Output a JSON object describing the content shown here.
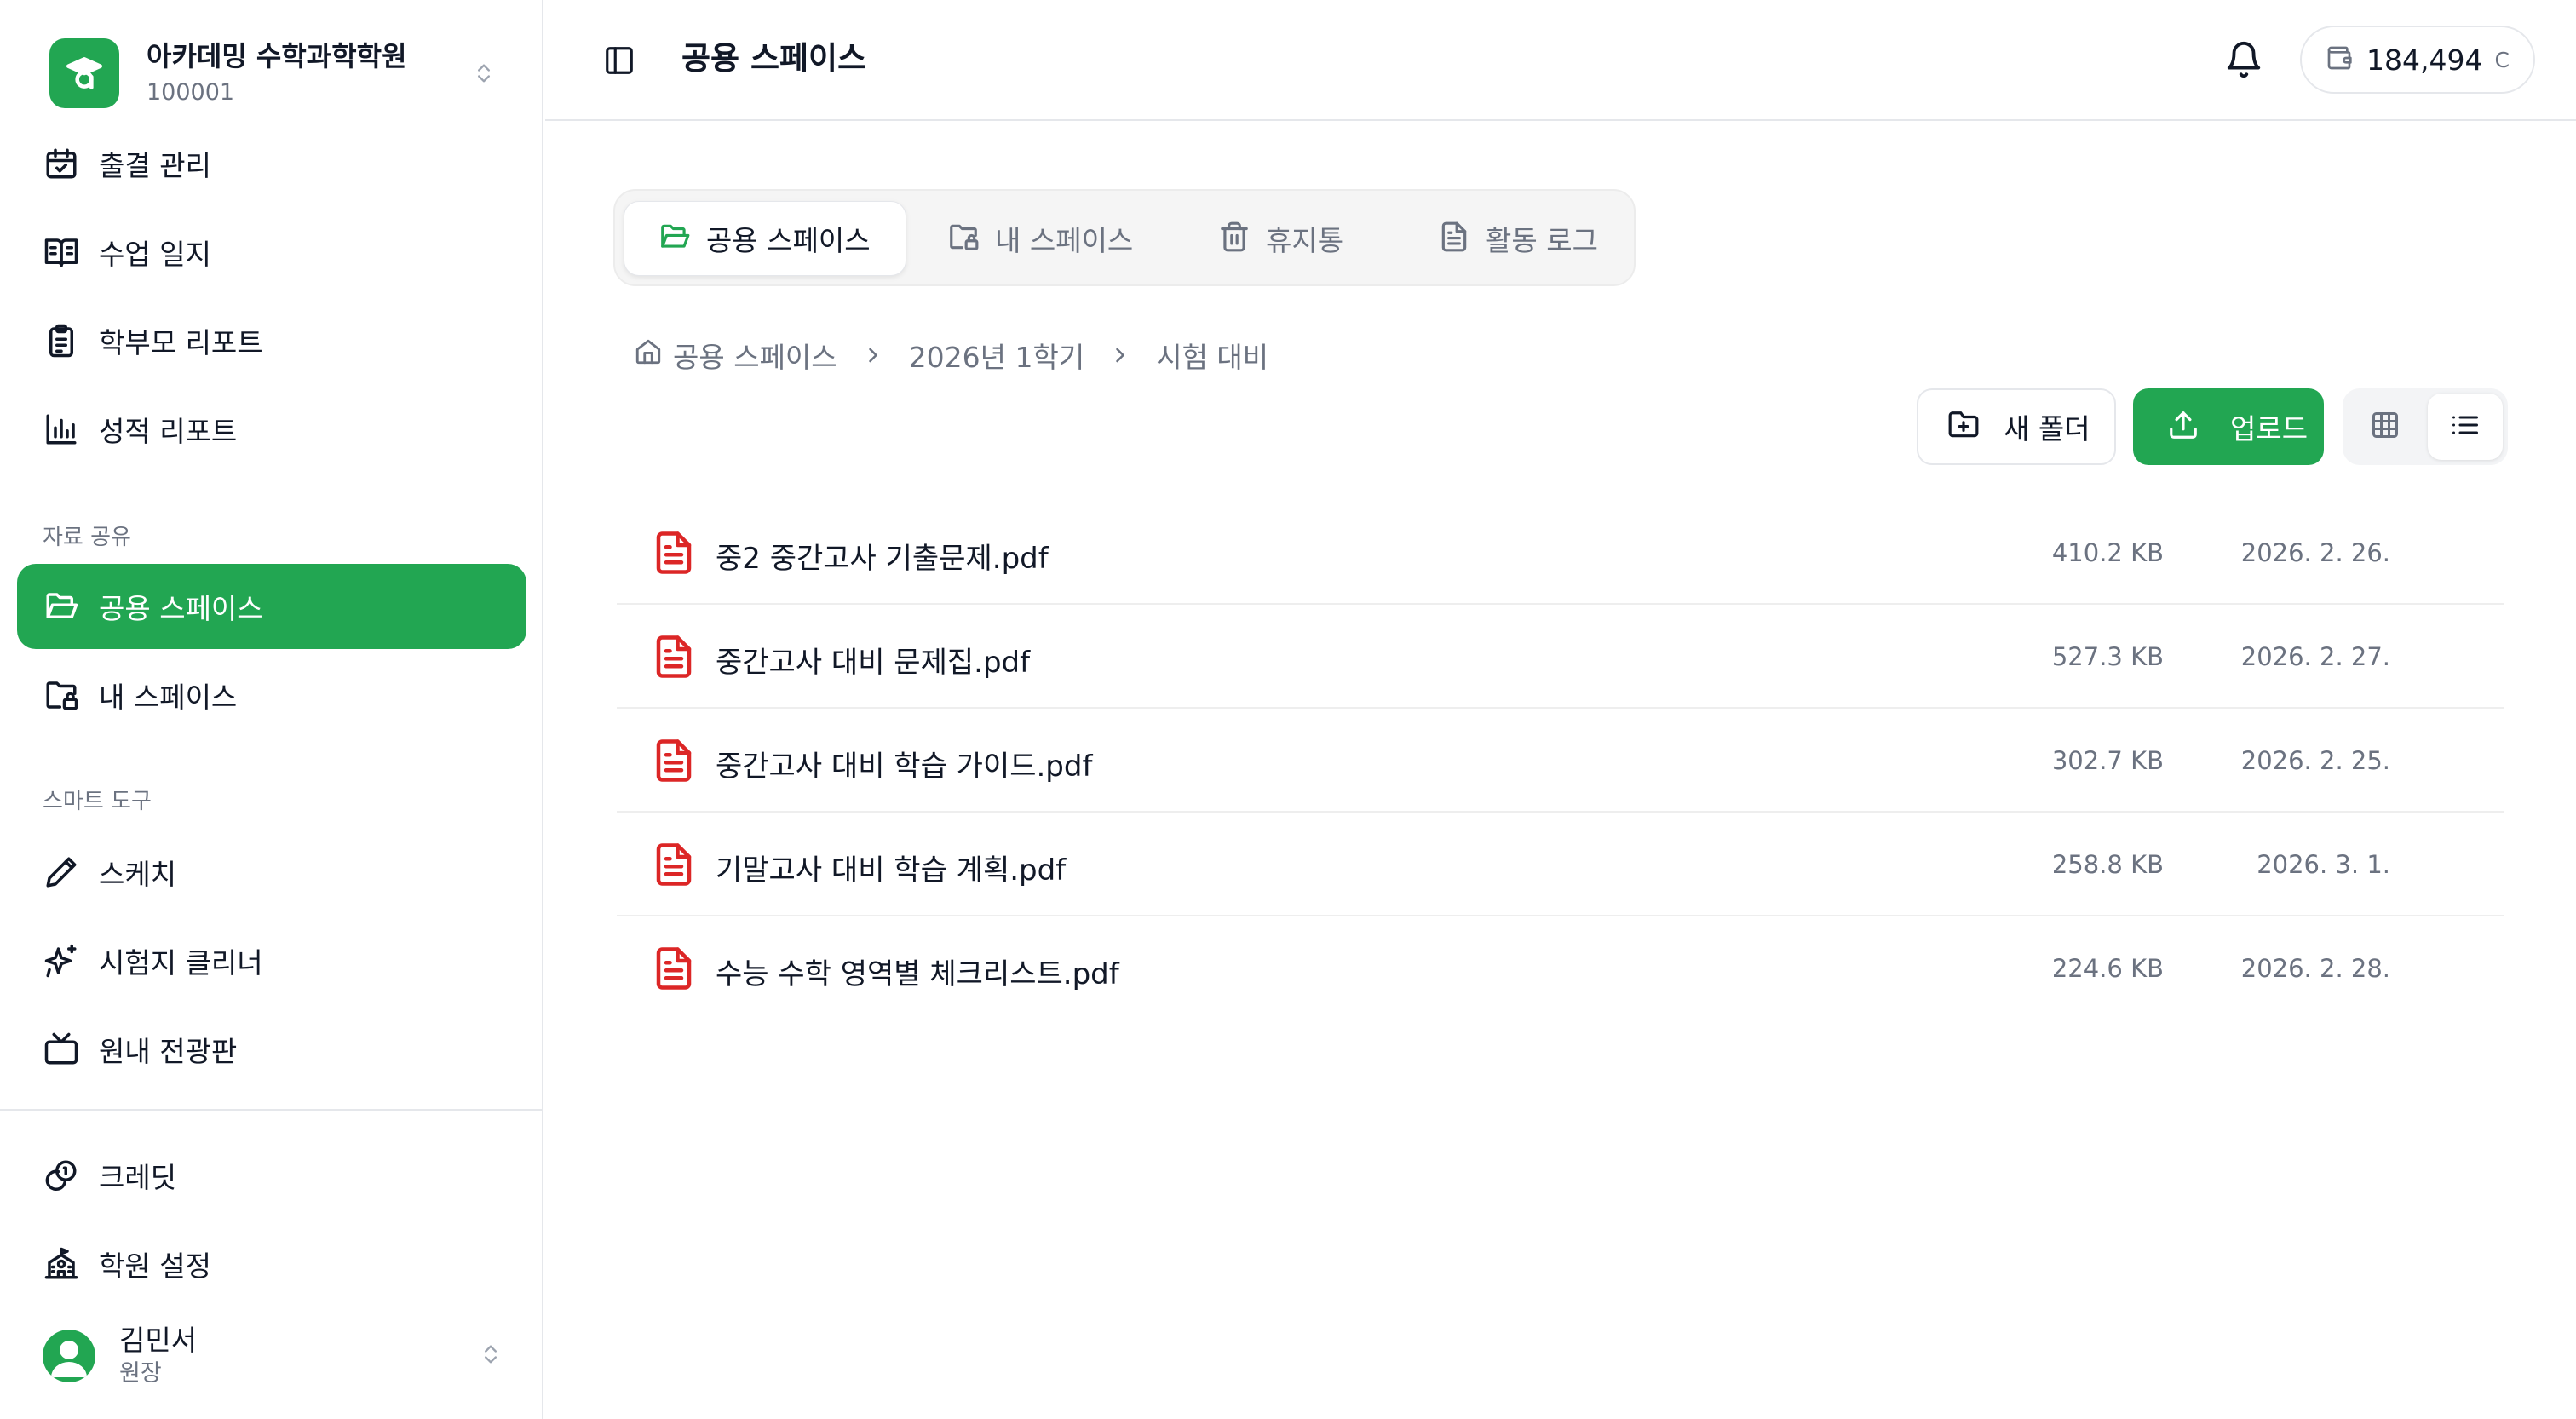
{
  "sidebar": {
    "org": {
      "name": "아카데밍 수학과학학원",
      "code": "100001"
    },
    "nav": [
      {
        "label": "출결 관리",
        "icon": "calendar-check-icon"
      },
      {
        "label": "수업 일지",
        "icon": "book-open-icon"
      },
      {
        "label": "학부모 리포트",
        "icon": "clipboard-icon"
      },
      {
        "label": "성적 리포트",
        "icon": "bar-chart-icon"
      }
    ],
    "section_share": "자료 공유",
    "share_items": [
      {
        "label": "공용 스페이스",
        "icon": "folder-open-icon",
        "active": true
      },
      {
        "label": "내 스페이스",
        "icon": "folder-lock-icon",
        "active": false
      }
    ],
    "section_tools": "스마트 도구",
    "tool_items": [
      {
        "label": "스케치",
        "icon": "pencil-icon"
      },
      {
        "label": "시험지 클리너",
        "icon": "sparkles-icon"
      },
      {
        "label": "원내 전광판",
        "icon": "tv-icon"
      }
    ],
    "bottom_items": [
      {
        "label": "크레딧",
        "icon": "coins-icon"
      },
      {
        "label": "학원 설정",
        "icon": "school-icon"
      }
    ],
    "user": {
      "name": "김민서",
      "role": "원장"
    }
  },
  "header": {
    "title": "공용 스페이스",
    "credit_amount": "184,494",
    "credit_unit": "C"
  },
  "tabs": [
    {
      "label": "공용 스페이스",
      "icon": "folder-open-icon",
      "active": true
    },
    {
      "label": "내 스페이스",
      "icon": "folder-lock-icon",
      "active": false
    },
    {
      "label": "휴지통",
      "icon": "trash-icon",
      "active": false
    },
    {
      "label": "활동 로그",
      "icon": "file-text-icon",
      "active": false
    }
  ],
  "breadcrumb": [
    "공용 스페이스",
    "2026년 1학기",
    "시험 대비"
  ],
  "toolbar": {
    "new_folder": "새 폴더",
    "upload": "업로드",
    "view_mode": "list"
  },
  "files": [
    {
      "name": "중2 중간고사 기출문제.pdf",
      "size": "410.2 KB",
      "date": "2026. 2. 26."
    },
    {
      "name": "중간고사 대비 문제집.pdf",
      "size": "527.3 KB",
      "date": "2026. 2. 27."
    },
    {
      "name": "중간고사 대비 학습 가이드.pdf",
      "size": "302.7 KB",
      "date": "2026. 2. 25."
    },
    {
      "name": "기말고사 대비 학습 계획.pdf",
      "size": "258.8 KB",
      "date": "2026. 3. 1."
    },
    {
      "name": "수능 수학 영역별 체크리스트.pdf",
      "size": "224.6 KB",
      "date": "2026. 2. 28."
    }
  ],
  "colors": {
    "accent": "#22a652",
    "pdf": "#dc2626",
    "muted": "#6b7280"
  }
}
